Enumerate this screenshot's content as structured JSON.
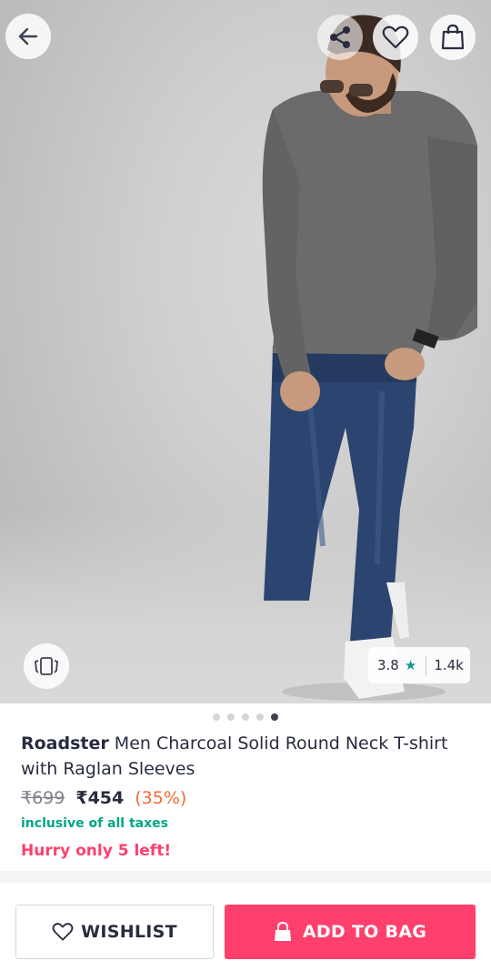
{
  "product": {
    "brand": "Roadster",
    "name": " Men Charcoal Solid Round Neck T-shirt with Raglan Sleeves",
    "mrp": "₹699",
    "price": "₹454",
    "discount": "(35%)",
    "tax_note": "inclusive of all taxes",
    "stock_note": "Hurry only 5 left!"
  },
  "rating": {
    "value": "3.8",
    "count": "1.4k"
  },
  "gallery": {
    "total_images": 5,
    "active_index": 4
  },
  "actions": {
    "wishlist_label": "WISHLIST",
    "add_to_bag_label": "ADD TO BAG"
  },
  "icons": {
    "back": "arrow-left-icon",
    "share": "share-icon",
    "wishlist": "heart-icon",
    "bag": "shopping-bag-icon",
    "similar": "view-similar-icon",
    "star": "star-icon",
    "lock": "bag-lock-icon"
  },
  "colors": {
    "accent": "#ff3f6c",
    "teal": "#03a685",
    "discount": "#f16b36",
    "star": "#14958f"
  }
}
